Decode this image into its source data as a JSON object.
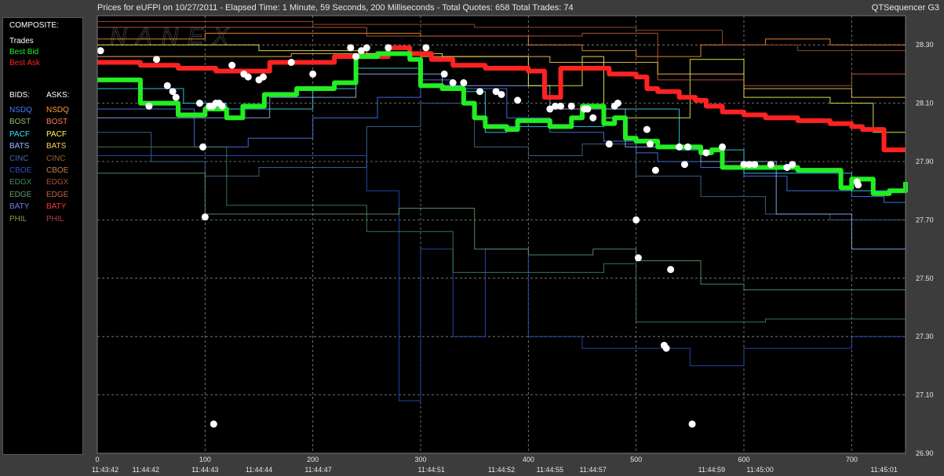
{
  "header": {
    "title": "Prices for  eUFPI  on  10/27/2011  -  Elapsed Time: 1 Minute, 59 Seconds, 200 Milliseconds  -  Total Quotes: 658  Total Trades: 74",
    "app_name": "QTSequencer G3"
  },
  "watermark": "NANEX",
  "legend": {
    "composite_heading": "COMPOSITE:",
    "composite": [
      {
        "label": "Trades",
        "color": "#ffffff"
      },
      {
        "label": "Best Bid",
        "color": "#22ee22"
      },
      {
        "label": "Best Ask",
        "color": "#ff2222"
      }
    ],
    "bids_heading": "BIDS:",
    "asks_heading": "ASKS:",
    "bids": [
      {
        "label": "NSDQ",
        "color": "#4a7cff"
      },
      {
        "label": "BOST",
        "color": "#8fbf6a"
      },
      {
        "label": "PACF",
        "color": "#33e0ff"
      },
      {
        "label": "BATS",
        "color": "#9ab8ff"
      },
      {
        "label": "CINC",
        "color": "#3f6fa0"
      },
      {
        "label": "CBOE",
        "color": "#2e4fbf"
      },
      {
        "label": "EDGX",
        "color": "#3f8a5a"
      },
      {
        "label": "EDGE",
        "color": "#5f9f6f"
      },
      {
        "label": "BATY",
        "color": "#6f7fdf"
      },
      {
        "label": "PHIL",
        "color": "#7f9f3f"
      }
    ],
    "asks": [
      {
        "label": "NSDQ",
        "color": "#ff9a3a"
      },
      {
        "label": "BOST",
        "color": "#ff7a5a"
      },
      {
        "label": "PACF",
        "color": "#ffff55"
      },
      {
        "label": "BATS",
        "color": "#ffd05a"
      },
      {
        "label": "CINC",
        "color": "#9f5f2f"
      },
      {
        "label": "CBOE",
        "color": "#cf7f3f"
      },
      {
        "label": "EDGX",
        "color": "#af4f2f"
      },
      {
        "label": "EDGE",
        "color": "#cf5f3f"
      },
      {
        "label": "BATY",
        "color": "#ff3333"
      },
      {
        "label": "PHIL",
        "color": "#bf3f3f"
      }
    ]
  },
  "chart_data": {
    "type": "line",
    "ylim": [
      26.9,
      28.4
    ],
    "y_ticks": [
      "28.30",
      "28.10",
      "27.90",
      "27.70",
      "27.50",
      "27.30",
      "27.10",
      "26.90"
    ],
    "xlim": [
      0,
      750
    ],
    "x_ticks": [
      {
        "value": 0,
        "label": "0"
      },
      {
        "value": 100,
        "label": "100"
      },
      {
        "value": 200,
        "label": "200"
      },
      {
        "value": 300,
        "label": "300"
      },
      {
        "value": 400,
        "label": "400"
      },
      {
        "value": 500,
        "label": "500"
      },
      {
        "value": 600,
        "label": "600"
      },
      {
        "value": 700,
        "label": "700"
      }
    ],
    "time_labels": [
      {
        "value": 0,
        "label": "11:43:42"
      },
      {
        "value": 45,
        "label": "11:44:42"
      },
      {
        "value": 100,
        "label": "11:44:43"
      },
      {
        "value": 150,
        "label": "11:44:44"
      },
      {
        "value": 205,
        "label": "11:44:47"
      },
      {
        "value": 310,
        "label": "11:44:51"
      },
      {
        "value": 375,
        "label": "11:44:52"
      },
      {
        "value": 420,
        "label": "11:44:55"
      },
      {
        "value": 460,
        "label": "11:44:57"
      },
      {
        "value": 570,
        "label": "11:44:59"
      },
      {
        "value": 615,
        "label": "11:45:00"
      },
      {
        "value": 730,
        "label": "11:45:01"
      }
    ],
    "series": [
      {
        "name": "Best Ask",
        "color": "#ff2222",
        "x": [
          0,
          40,
          75,
          110,
          160,
          220,
          270,
          290,
          310,
          330,
          360,
          400,
          415,
          430,
          475,
          500,
          510,
          520,
          540,
          555,
          565,
          580,
          600,
          620,
          650,
          680,
          700,
          710,
          730,
          750
        ],
        "y": [
          28.24,
          28.23,
          28.22,
          28.21,
          28.24,
          28.26,
          28.29,
          28.27,
          28.25,
          28.23,
          28.22,
          28.21,
          28.12,
          28.22,
          28.2,
          28.19,
          28.15,
          28.14,
          28.12,
          28.11,
          28.09,
          28.07,
          28.06,
          28.05,
          28.04,
          28.03,
          28.02,
          28.01,
          27.94,
          27.94
        ]
      },
      {
        "name": "Best Bid",
        "color": "#22ee22",
        "x": [
          0,
          40,
          75,
          100,
          120,
          135,
          155,
          185,
          200,
          220,
          240,
          260,
          290,
          300,
          320,
          340,
          350,
          360,
          380,
          390,
          420,
          440,
          450,
          470,
          480,
          490,
          500,
          520,
          550,
          560,
          570,
          580,
          600,
          620,
          650,
          670,
          690,
          700,
          720,
          735,
          750
        ],
        "y": [
          28.18,
          28.1,
          28.06,
          28.08,
          28.05,
          28.09,
          28.13,
          28.15,
          28.15,
          28.17,
          28.26,
          28.27,
          28.25,
          28.16,
          28.15,
          28.1,
          28.05,
          28.02,
          28.01,
          28.04,
          28.02,
          28.05,
          28.09,
          28.03,
          28.05,
          27.98,
          27.97,
          27.95,
          27.95,
          27.93,
          27.94,
          27.88,
          27.88,
          27.88,
          27.87,
          27.87,
          27.81,
          27.84,
          27.79,
          27.8,
          27.83
        ]
      }
    ],
    "trades": [
      {
        "x": 3,
        "y": 28.28
      },
      {
        "x": 48,
        "y": 28.09
      },
      {
        "x": 55,
        "y": 28.25
      },
      {
        "x": 65,
        "y": 28.16
      },
      {
        "x": 70,
        "y": 28.14
      },
      {
        "x": 73,
        "y": 28.12
      },
      {
        "x": 95,
        "y": 28.1
      },
      {
        "x": 98,
        "y": 27.95
      },
      {
        "x": 100,
        "y": 27.71
      },
      {
        "x": 104,
        "y": 28.09
      },
      {
        "x": 107,
        "y": 28.09
      },
      {
        "x": 110,
        "y": 28.1
      },
      {
        "x": 113,
        "y": 28.1
      },
      {
        "x": 116,
        "y": 28.09
      },
      {
        "x": 125,
        "y": 28.23
      },
      {
        "x": 136,
        "y": 28.2
      },
      {
        "x": 140,
        "y": 28.19
      },
      {
        "x": 150,
        "y": 28.18
      },
      {
        "x": 154,
        "y": 28.19
      },
      {
        "x": 180,
        "y": 28.24
      },
      {
        "x": 200,
        "y": 28.2
      },
      {
        "x": 235,
        "y": 28.29
      },
      {
        "x": 240,
        "y": 28.26
      },
      {
        "x": 245,
        "y": 28.28
      },
      {
        "x": 250,
        "y": 28.29
      },
      {
        "x": 270,
        "y": 28.29
      },
      {
        "x": 305,
        "y": 28.29
      },
      {
        "x": 322,
        "y": 28.2
      },
      {
        "x": 330,
        "y": 28.17
      },
      {
        "x": 340,
        "y": 28.17
      },
      {
        "x": 355,
        "y": 28.14
      },
      {
        "x": 370,
        "y": 28.14
      },
      {
        "x": 375,
        "y": 28.13
      },
      {
        "x": 390,
        "y": 28.11
      },
      {
        "x": 420,
        "y": 28.08
      },
      {
        "x": 425,
        "y": 28.09
      },
      {
        "x": 430,
        "y": 28.09
      },
      {
        "x": 440,
        "y": 28.09
      },
      {
        "x": 452,
        "y": 28.08
      },
      {
        "x": 455,
        "y": 28.08
      },
      {
        "x": 460,
        "y": 28.05
      },
      {
        "x": 475,
        "y": 27.96
      },
      {
        "x": 480,
        "y": 28.09
      },
      {
        "x": 483,
        "y": 28.1
      },
      {
        "x": 500,
        "y": 27.7
      },
      {
        "x": 502,
        "y": 27.57
      },
      {
        "x": 510,
        "y": 28.01
      },
      {
        "x": 513,
        "y": 27.96
      },
      {
        "x": 518,
        "y": 27.87
      },
      {
        "x": 526,
        "y": 27.27
      },
      {
        "x": 528,
        "y": 27.26
      },
      {
        "x": 532,
        "y": 27.53
      },
      {
        "x": 540,
        "y": 27.95
      },
      {
        "x": 545,
        "y": 27.89
      },
      {
        "x": 548,
        "y": 27.95
      },
      {
        "x": 552,
        "y": 27.0
      },
      {
        "x": 565,
        "y": 27.93
      },
      {
        "x": 580,
        "y": 27.95
      },
      {
        "x": 600,
        "y": 27.89
      },
      {
        "x": 605,
        "y": 27.89
      },
      {
        "x": 610,
        "y": 27.89
      },
      {
        "x": 625,
        "y": 27.89
      },
      {
        "x": 640,
        "y": 27.88
      },
      {
        "x": 645,
        "y": 27.89
      },
      {
        "x": 705,
        "y": 27.83
      },
      {
        "x": 706,
        "y": 27.82
      },
      {
        "x": 108,
        "y": 27.0
      }
    ],
    "exchange_lines": [
      {
        "color": "#4a7cff",
        "x": [
          0,
          60,
          90,
          140,
          200,
          260,
          300,
          330,
          380,
          420,
          470,
          500,
          520,
          560,
          600,
          640,
          700,
          730,
          750
        ],
        "y": [
          28.08,
          28.08,
          27.95,
          27.98,
          28.05,
          28.12,
          28.18,
          28.15,
          28.05,
          28.0,
          27.97,
          27.93,
          27.9,
          27.88,
          27.85,
          27.8,
          27.78,
          27.76,
          27.78
        ]
      },
      {
        "color": "#33e0ff",
        "x": [
          0,
          80,
          120,
          200,
          240,
          300,
          340,
          360,
          380,
          430,
          470,
          540,
          600,
          650,
          700,
          750
        ],
        "y": [
          28.15,
          28.1,
          28.08,
          28.15,
          28.22,
          28.16,
          28.14,
          28.0,
          28.02,
          28.02,
          28.08,
          27.94,
          27.86,
          27.86,
          27.8,
          27.82
        ]
      },
      {
        "color": "#3f6fa0",
        "x": [
          0,
          50,
          100,
          150,
          250,
          300,
          350,
          400,
          450,
          500,
          560,
          620,
          680,
          750
        ],
        "y": [
          28.0,
          27.9,
          27.85,
          27.88,
          28.02,
          28.1,
          27.95,
          27.92,
          27.96,
          27.85,
          27.78,
          27.72,
          27.7,
          27.74
        ]
      },
      {
        "color": "#2e4fbf",
        "x": [
          0,
          200,
          250,
          280,
          300,
          330,
          360,
          400,
          450,
          500,
          550,
          600,
          650,
          700,
          750
        ],
        "y": [
          27.92,
          27.92,
          27.8,
          27.08,
          27.6,
          27.3,
          27.6,
          27.3,
          27.26,
          27.26,
          27.2,
          27.26,
          27.26,
          27.3,
          27.3
        ]
      },
      {
        "color": "#5f9f6f",
        "x": [
          0,
          100,
          200,
          280,
          330,
          350,
          400,
          460,
          500,
          560,
          600,
          700,
          750
        ],
        "y": [
          27.86,
          27.72,
          27.72,
          27.74,
          27.74,
          27.6,
          27.58,
          27.6,
          27.56,
          27.48,
          27.46,
          27.46,
          27.42
        ]
      },
      {
        "color": "#3f8a5a",
        "x": [
          0,
          120,
          250,
          330,
          400,
          470,
          500,
          560,
          620,
          700,
          750
        ],
        "y": [
          27.95,
          27.75,
          27.66,
          27.52,
          27.52,
          27.55,
          27.35,
          27.35,
          27.36,
          27.36,
          27.28
        ]
      },
      {
        "color": "#9ab8ff",
        "x": [
          0,
          90,
          160,
          240,
          320,
          420,
          490,
          560,
          630,
          700,
          750
        ],
        "y": [
          28.05,
          28.05,
          28.12,
          28.2,
          28.16,
          28.08,
          27.95,
          27.9,
          27.72,
          27.6,
          27.7
        ]
      },
      {
        "color": "#ff9a3a",
        "x": [
          0,
          100,
          200,
          300,
          400,
          450,
          500,
          560,
          620,
          680,
          750
        ],
        "y": [
          28.32,
          28.34,
          28.34,
          28.33,
          28.3,
          28.28,
          28.26,
          28.3,
          28.32,
          28.3,
          28.28
        ]
      },
      {
        "color": "#ffff55",
        "x": [
          0,
          150,
          250,
          320,
          400,
          450,
          470,
          550,
          600,
          680,
          720,
          750
        ],
        "y": [
          28.3,
          28.28,
          28.27,
          28.26,
          28.16,
          28.26,
          28.05,
          28.25,
          28.12,
          28.1,
          28.0,
          28.3
        ]
      },
      {
        "color": "#cf5f3f",
        "x": [
          0,
          120,
          250,
          380,
          450,
          520,
          600,
          700,
          750
        ],
        "y": [
          28.36,
          28.36,
          28.33,
          28.33,
          28.34,
          28.18,
          28.16,
          28.2,
          28.18
        ]
      },
      {
        "color": "#af4f2f",
        "x": [
          0,
          200,
          350,
          500,
          580,
          650,
          750
        ],
        "y": [
          28.38,
          28.37,
          28.36,
          28.35,
          28.3,
          28.28,
          28.24
        ]
      },
      {
        "color": "#ffd05a",
        "x": [
          0,
          180,
          300,
          420,
          520,
          600,
          700,
          750
        ],
        "y": [
          28.26,
          28.27,
          28.26,
          28.24,
          28.2,
          28.15,
          28.12,
          28.1
        ]
      }
    ]
  }
}
